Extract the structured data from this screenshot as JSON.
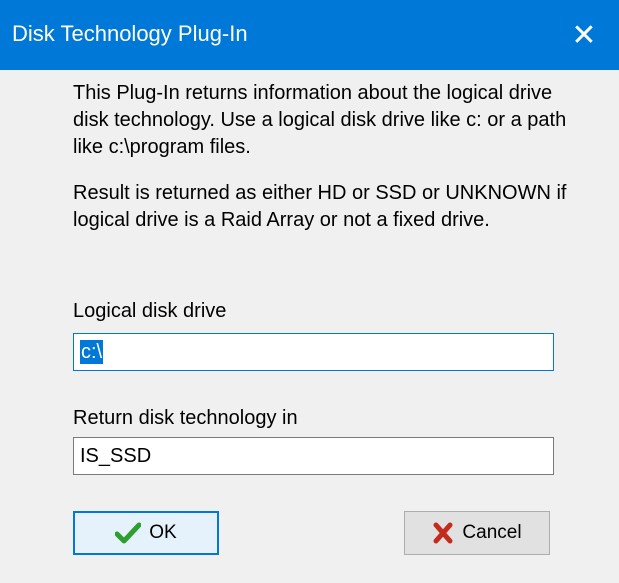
{
  "window": {
    "title": "Disk Technology Plug-In",
    "close_glyph": "✕"
  },
  "description": {
    "paragraph1": "This Plug-In returns information about the logical drive disk technology. Use a logical disk drive like c: or a path like c:\\program files.",
    "paragraph2": "Result is returned as either HD or SSD or UNKNOWN if logical drive is a Raid Array or not a fixed drive."
  },
  "fields": {
    "drive_label": "Logical disk drive",
    "drive_value": "c:\\",
    "return_label": "Return disk technology in",
    "return_value": "IS_SSD"
  },
  "buttons": {
    "ok_label": "OK",
    "cancel_label": "Cancel"
  },
  "icons": {
    "ok": "checkmark-icon",
    "cancel": "x-mark-icon",
    "close": "close-icon"
  },
  "colors": {
    "titlebar": "#0078d7",
    "selection": "#0078d7",
    "ok_check": "#2e9e2e",
    "cancel_x": "#c42b1c"
  }
}
